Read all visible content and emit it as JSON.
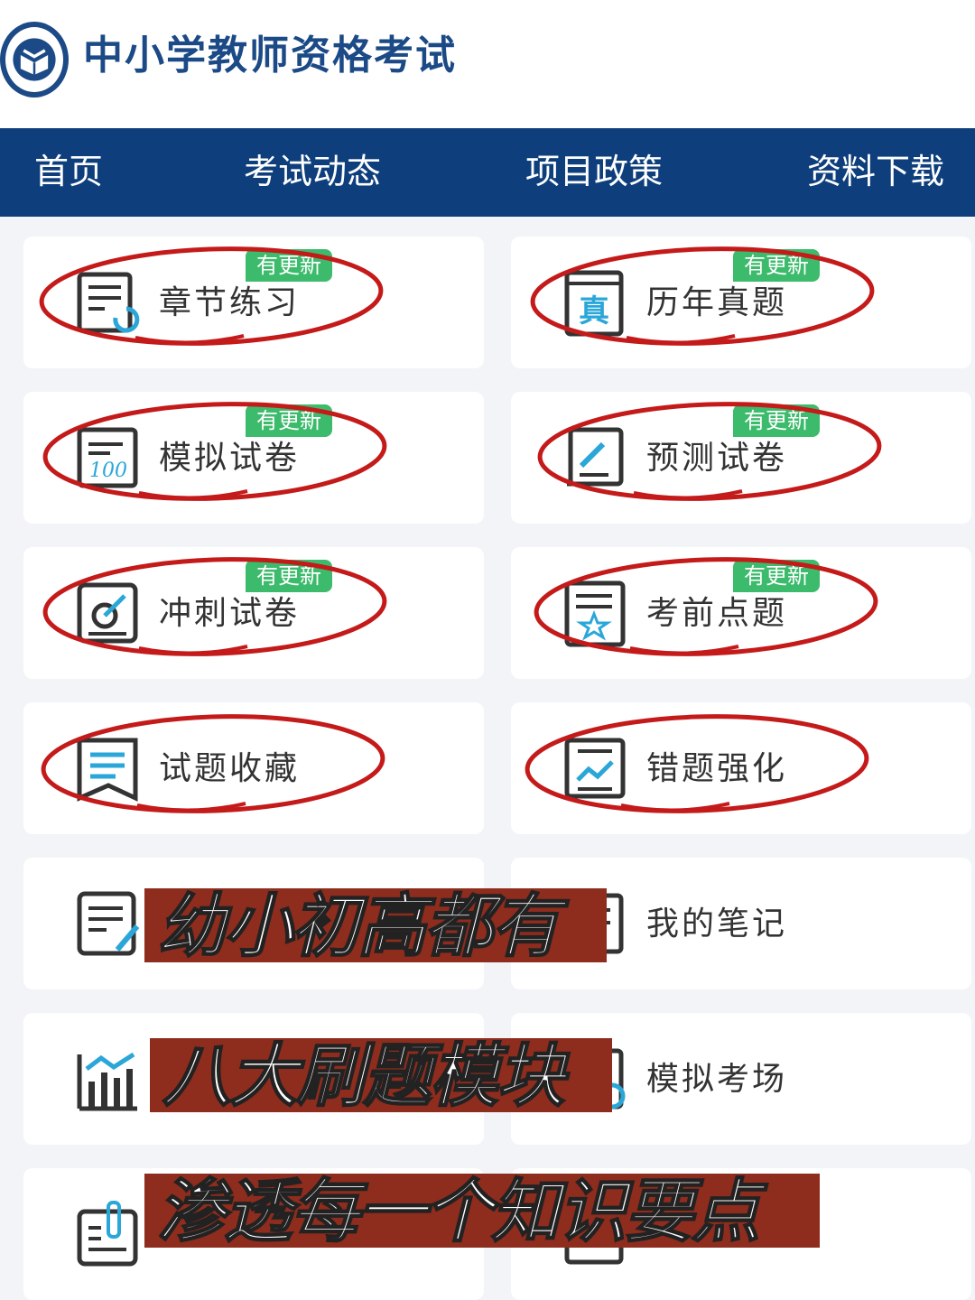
{
  "header": {
    "title": "中小学教师资格考试",
    "logo_icon": "book-seal-icon"
  },
  "nav": {
    "items": [
      "首页",
      "考试动态",
      "项目政策",
      "资料下载"
    ]
  },
  "badge_label": "有更新",
  "modules": [
    {
      "label": "章节练习",
      "icon": "chapter-practice-icon",
      "badge": true,
      "circled": true
    },
    {
      "label": "历年真题",
      "icon": "past-papers-icon",
      "badge": true,
      "circled": true
    },
    {
      "label": "模拟试卷",
      "icon": "mock-paper-icon",
      "badge": true,
      "circled": true
    },
    {
      "label": "预测试卷",
      "icon": "forecast-paper-icon",
      "badge": true,
      "circled": true
    },
    {
      "label": "冲刺试卷",
      "icon": "sprint-paper-icon",
      "badge": true,
      "circled": true
    },
    {
      "label": "考前点题",
      "icon": "key-points-icon",
      "badge": true,
      "circled": true
    },
    {
      "label": "试题收藏",
      "icon": "bookmark-icon",
      "badge": false,
      "circled": true
    },
    {
      "label": "错题强化",
      "icon": "wrong-questions-icon",
      "badge": false,
      "circled": true
    },
    {
      "label": "",
      "icon": "notes-edit-icon",
      "badge": false,
      "circled": false
    },
    {
      "label": "我的笔记",
      "icon": "my-notes-icon",
      "badge": false,
      "circled": false
    },
    {
      "label": "",
      "icon": "statistics-icon",
      "badge": false,
      "circled": false
    },
    {
      "label": "模拟考场",
      "icon": "mock-exam-icon",
      "badge": false,
      "circled": false
    },
    {
      "label": "",
      "icon": "pen-list-icon",
      "badge": false,
      "circled": false
    },
    {
      "label": "",
      "icon": "document-icon",
      "badge": false,
      "circled": false
    }
  ],
  "captions": [
    "幼小初高都有",
    "八大刷题模块",
    "渗透每一个知识要点"
  ],
  "colors": {
    "nav_bg": "#0e3f7c",
    "title": "#1b4a86",
    "badge": "#3dbb6c",
    "circle": "#c41a1a",
    "caption_bg": "#8e2c1d",
    "icon_accent": "#2aa7d8"
  }
}
